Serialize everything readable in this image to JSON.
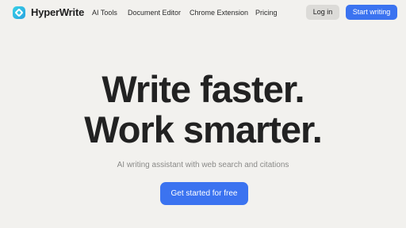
{
  "brand": {
    "name": "HyperWrite",
    "logo_icon": "hyperwrite-logo-icon",
    "accent": "#3b73f0"
  },
  "nav": {
    "links": [
      "AI Tools",
      "Document Editor",
      "Chrome Extension",
      "Pricing"
    ],
    "login_label": "Log in",
    "start_label": "Start writing"
  },
  "hero": {
    "title_line1": "Write faster.",
    "title_line2": "Work smarter.",
    "subtitle": "AI writing assistant with web search and citations",
    "cta_label": "Get started for free"
  },
  "colors": {
    "background": "#f2f1ee",
    "primary_button": "#3b73f0",
    "secondary_button": "#dcdbd8",
    "heading": "#222222",
    "muted_text": "#8a8a88"
  }
}
